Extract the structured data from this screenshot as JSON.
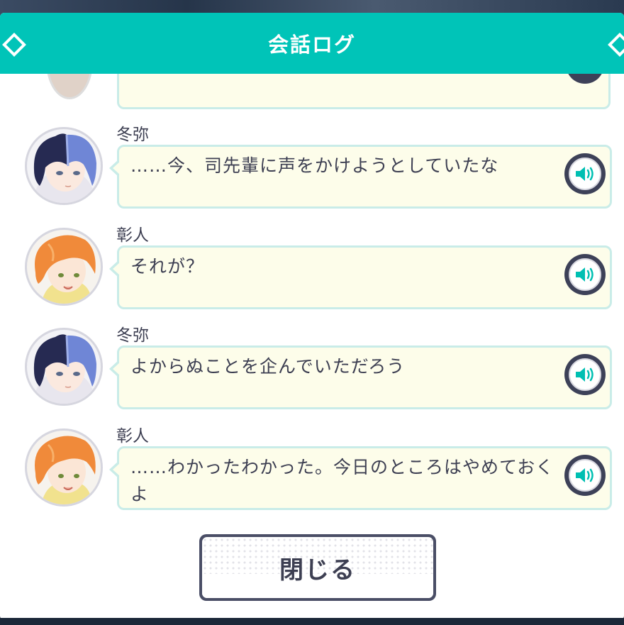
{
  "header": {
    "title": "会話ログ"
  },
  "entries": [
    {
      "speaker": "冬弥",
      "text": "……今、司先輩に声をかけようとしていたな",
      "avatar_icon": "toya-avatar-icon"
    },
    {
      "speaker": "彰人",
      "text": "それが？",
      "avatar_icon": "akito-avatar-icon"
    },
    {
      "speaker": "冬弥",
      "text": "よからぬことを企んでいただろう",
      "avatar_icon": "toya-avatar-icon"
    },
    {
      "speaker": "彰人",
      "text": "……わかったわかった。今日のところはやめておくよ",
      "avatar_icon": "akito-avatar-icon"
    }
  ],
  "footer": {
    "close_label": "閉じる"
  },
  "colors": {
    "header": "#00c4b8",
    "bubble_bg": "#fdfdea",
    "bubble_border": "#c9ece8",
    "text": "#3d3f52",
    "audio_icon": "#00bfb2"
  }
}
